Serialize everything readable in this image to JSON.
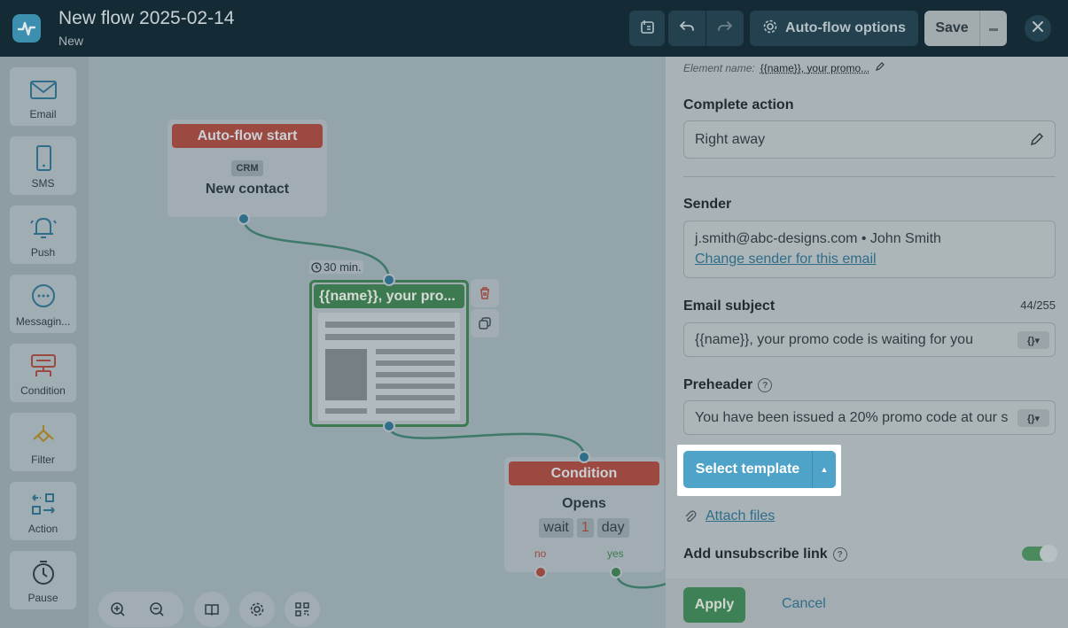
{
  "header": {
    "title": "New flow 2025-02-14",
    "subtitle": "New",
    "auto_flow_options": "Auto-flow options",
    "save": "Save"
  },
  "sidebar": {
    "items": [
      {
        "label": "Email",
        "icon": "envelope-icon"
      },
      {
        "label": "SMS",
        "icon": "phone-icon"
      },
      {
        "label": "Push",
        "icon": "bell-icon"
      },
      {
        "label": "Messagin...",
        "icon": "chat-icon"
      },
      {
        "label": "Condition",
        "icon": "condition-icon"
      },
      {
        "label": "Filter",
        "icon": "filter-icon"
      },
      {
        "label": "Action",
        "icon": "action-icon"
      },
      {
        "label": "Pause",
        "icon": "clock-icon"
      }
    ]
  },
  "canvas": {
    "start_node": {
      "header": "Auto-flow start",
      "badge": "CRM",
      "title": "New contact"
    },
    "email_node": {
      "delay": "30 min.",
      "header": "{{name}}, your pro..."
    },
    "condition_node": {
      "header": "Condition",
      "title": "Opens",
      "wait": "wait",
      "wait_value": "1",
      "wait_unit": "day",
      "no": "no",
      "yes": "yes"
    }
  },
  "panel": {
    "element_name_label": "Element name:",
    "element_name_value": "{{name}}, your promo...",
    "complete_action_label": "Complete action",
    "complete_action_value": "Right away",
    "sender_label": "Sender",
    "sender_value": "j.smith@abc-designs.com • John Smith",
    "change_sender": "Change sender for this email",
    "subject_label": "Email subject",
    "subject_count": "44/255",
    "subject_value": "{{name}}, your promo code is waiting for you",
    "preheader_label": "Preheader",
    "preheader_value": "You have been issued a 20% promo code at our s",
    "select_template": "Select template",
    "attach_files": "Attach files",
    "unsubscribe_label": "Add unsubscribe link",
    "unsubscribe_enabled": true
  },
  "footer": {
    "apply": "Apply",
    "cancel": "Cancel"
  }
}
